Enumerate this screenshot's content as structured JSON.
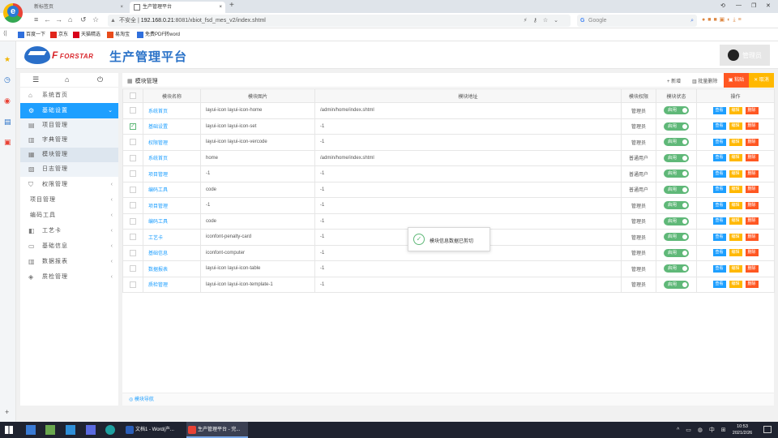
{
  "browser": {
    "tabs": [
      {
        "label": "新标签页"
      },
      {
        "label": "生产管理平台"
      }
    ],
    "url_warning": "不安全",
    "url_host": "192.168.0.21",
    "url_path": ":8081/xbiot_fsd_mes_v2/index.shtml",
    "search_placeholder": "Google",
    "bookmarks": [
      {
        "label": "百度一下",
        "color": "#2f6fdc"
      },
      {
        "label": "京东",
        "color": "#e1251b"
      },
      {
        "label": "天猫精选",
        "color": "#d8001a"
      },
      {
        "label": "易淘宝",
        "color": "#e84b1b"
      },
      {
        "label": "免费PDF转word",
        "color": "#2f6fdc"
      }
    ]
  },
  "app": {
    "brand": "FORSTAR",
    "brand_mark": "F",
    "title": "生产管理平台",
    "user_name": "管理员"
  },
  "sidebar": {
    "items": [
      {
        "label": "系统首页",
        "icon": "home-icon"
      },
      {
        "label": "基础设置",
        "icon": "gear-icon"
      },
      {
        "label": "项目管理",
        "icon": "list-icon"
      },
      {
        "label": "字典管理",
        "icon": "dict-icon"
      },
      {
        "label": "模块管理",
        "icon": "module-icon"
      },
      {
        "label": "日志管理",
        "icon": "log-icon"
      },
      {
        "label": "权限管理",
        "icon": "shield-icon"
      },
      {
        "label": "项目管理",
        "icon": ""
      },
      {
        "label": "编码工具",
        "icon": ""
      },
      {
        "label": "工艺卡",
        "icon": "card-icon"
      },
      {
        "label": "基础信息",
        "icon": "monitor-icon"
      },
      {
        "label": "数据报表",
        "icon": "table-icon"
      },
      {
        "label": "质检管理",
        "icon": "stack-icon"
      }
    ]
  },
  "panel": {
    "title": "模块管理",
    "add_label": "新增",
    "batch_delete_label": "批量删除",
    "paste_label": "粘贴",
    "cancel_label": "取消",
    "footer_label": "模块导航",
    "columns": [
      "模块名称",
      "模块图片",
      "模块地址",
      "模块权限",
      "模块状态",
      "操作"
    ],
    "status_label": "启用",
    "actions": {
      "view": "查看",
      "edit": "编辑",
      "delete": "删除"
    },
    "rows": [
      {
        "name": "系统首页",
        "icon": "layui-icon layui-icon-home",
        "url": "/admin/home/index.shtml",
        "perm": "管理员",
        "checked": false
      },
      {
        "name": "基础设置",
        "icon": "layui-icon layui-icon-set",
        "url": "-1",
        "perm": "管理员",
        "checked": true
      },
      {
        "name": "权限管理",
        "icon": "layui-icon layui-icon-vercode",
        "url": "-1",
        "perm": "管理员",
        "checked": false
      },
      {
        "name": "系统首页",
        "icon": "home",
        "url": "/admin/home/index.shtml",
        "perm": "普通用户",
        "checked": false
      },
      {
        "name": "项目管理",
        "icon": "-1",
        "url": "-1",
        "perm": "普通用户",
        "checked": false
      },
      {
        "name": "编码工具",
        "icon": "code",
        "url": "-1",
        "perm": "普通用户",
        "checked": false
      },
      {
        "name": "项目管理",
        "icon": "-1",
        "url": "-1",
        "perm": "管理员",
        "checked": false
      },
      {
        "name": "编码工具",
        "icon": "code",
        "url": "-1",
        "perm": "管理员",
        "checked": false
      },
      {
        "name": "工艺卡",
        "icon": "iconfont-penalty-card",
        "url": "-1",
        "perm": "管理员",
        "checked": false
      },
      {
        "name": "基础信息",
        "icon": "iconfont-computer",
        "url": "-1",
        "perm": "管理员",
        "checked": false
      },
      {
        "name": "数据报表",
        "icon": "layui-icon layui-icon-table",
        "url": "-1",
        "perm": "管理员",
        "checked": false
      },
      {
        "name": "质检管理",
        "icon": "layui-icon layui-icon-template-1",
        "url": "-1",
        "perm": "管理员",
        "checked": false
      }
    ]
  },
  "toast": {
    "message": "模块信息数据已剪切"
  },
  "taskbar": {
    "apps": [
      {
        "label": "文档1 - Word(产...",
        "color": "#2b5fb8"
      },
      {
        "label": "生产管理平台 - 完...",
        "color": "#e94235"
      }
    ],
    "time": "10:53",
    "date": "2021/2/26",
    "ime": "中"
  },
  "colors": {
    "accent": "#1e9fff",
    "status_green": "#5fb878",
    "edit_orange": "#ffb800",
    "delete_red": "#ff5722",
    "title_blue": "#2a72c8"
  }
}
